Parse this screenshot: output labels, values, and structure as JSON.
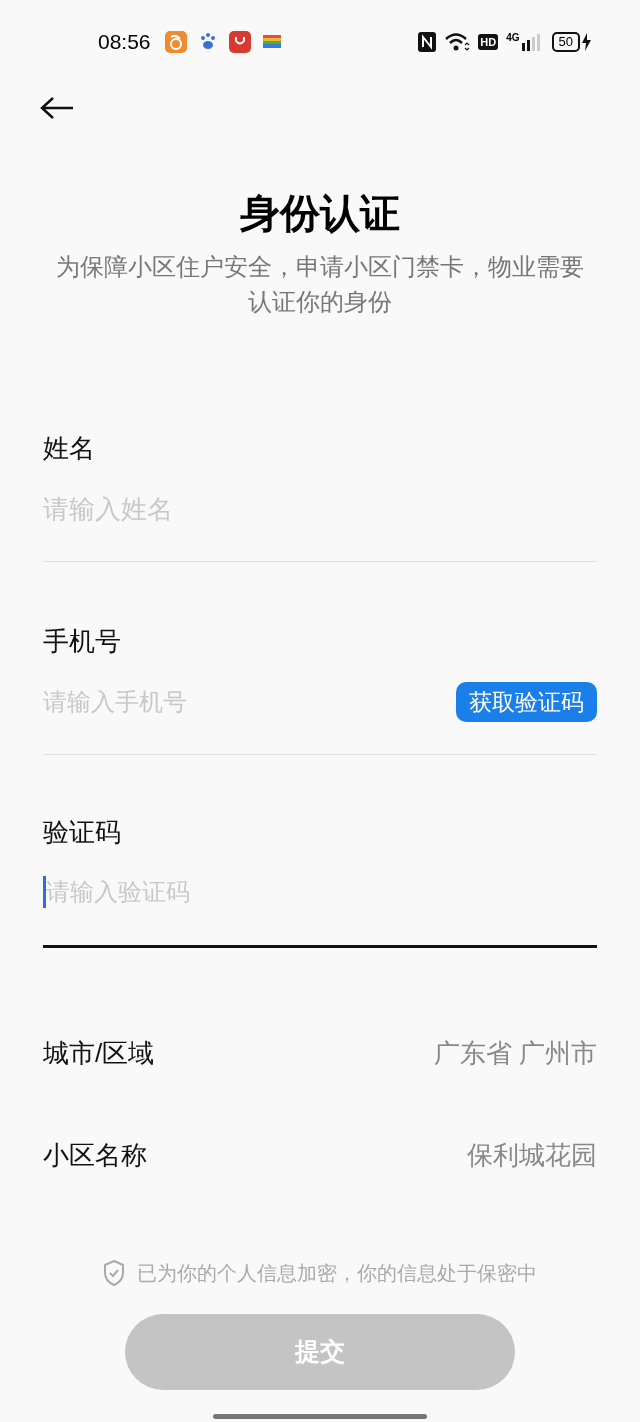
{
  "status_bar": {
    "time": "08:56",
    "network": "4G",
    "hd": "HD",
    "battery": "50"
  },
  "header": {
    "title": "身份认证",
    "subtitle": "为保障小区住户安全，申请小区门禁卡，物业需要认证你的身份"
  },
  "fields": [
    {
      "label": "姓名",
      "placeholder": "请输入姓名",
      "focused": false
    },
    {
      "label": "手机号",
      "placeholder": "请输入手机号",
      "focused": false,
      "action": "获取验证码"
    },
    {
      "label": "验证码",
      "placeholder": "请输入验证码",
      "focused": true
    }
  ],
  "selects": [
    {
      "label": "城市/区域",
      "value": "广东省 广州市"
    },
    {
      "label": "小区名称",
      "value": "保利城花园"
    }
  ],
  "notice": "已为你的个人信息加密，你的信息处于保密中",
  "submit": {
    "label": "提交",
    "disabled": true
  }
}
